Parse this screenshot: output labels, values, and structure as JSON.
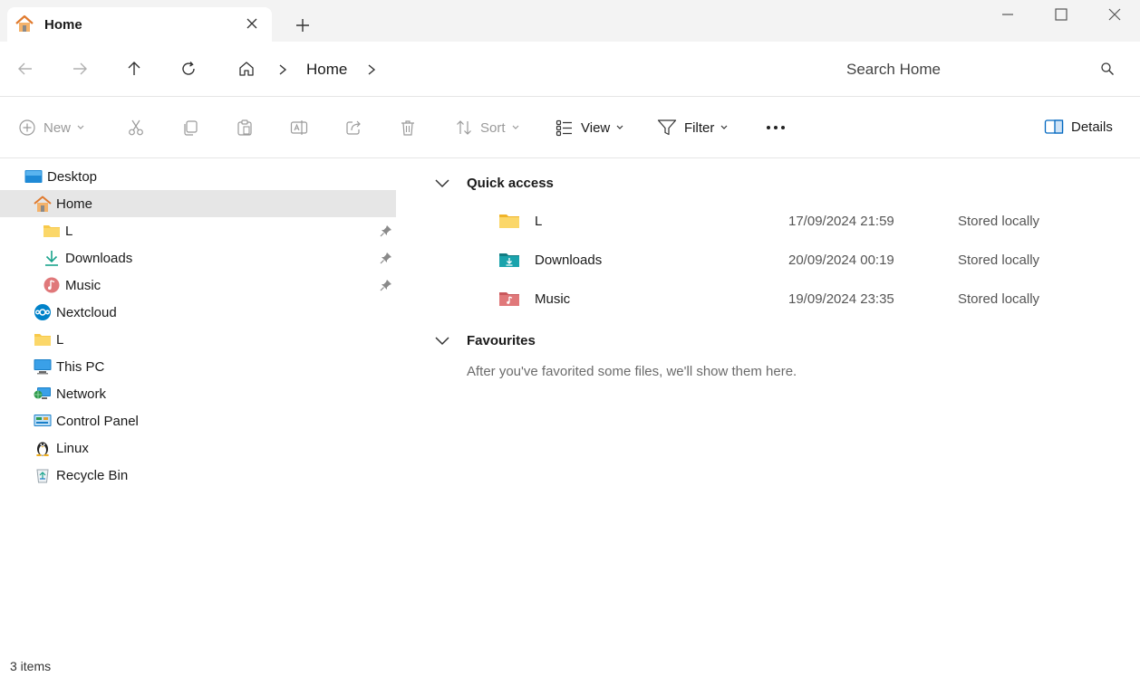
{
  "window": {
    "tab_title": "Home"
  },
  "address": {
    "crumb": "Home",
    "search_placeholder": "Search Home"
  },
  "toolbar": {
    "new_label": "New",
    "sort_label": "Sort",
    "view_label": "View",
    "filter_label": "Filter",
    "details_label": "Details"
  },
  "sidebar": {
    "items": [
      {
        "label": "Desktop",
        "icon": "desktop-icon"
      },
      {
        "label": "Home",
        "icon": "home-icon"
      },
      {
        "label": "L",
        "icon": "folder-icon"
      },
      {
        "label": "Downloads",
        "icon": "download-icon"
      },
      {
        "label": "Music",
        "icon": "music-icon"
      },
      {
        "label": "Nextcloud",
        "icon": "nextcloud-icon"
      },
      {
        "label": "L",
        "icon": "folder-icon"
      },
      {
        "label": "This PC",
        "icon": "monitor-icon"
      },
      {
        "label": "Network",
        "icon": "network-icon"
      },
      {
        "label": "Control Panel",
        "icon": "control-panel-icon"
      },
      {
        "label": "Linux",
        "icon": "linux-icon"
      },
      {
        "label": "Recycle Bin",
        "icon": "recycle-bin-icon"
      }
    ]
  },
  "main": {
    "quick_access_title": "Quick access",
    "favourites_title": "Favourites",
    "favourites_empty": "After you've favorited some files, we'll show them here.",
    "files": [
      {
        "name": "L",
        "date": "17/09/2024 21:59",
        "status": "Stored locally"
      },
      {
        "name": "Downloads",
        "date": "20/09/2024 00:19",
        "status": "Stored locally"
      },
      {
        "name": "Music",
        "date": "19/09/2024 23:35",
        "status": "Stored locally"
      }
    ]
  },
  "status": {
    "count": "3 items"
  },
  "colors": {
    "accent": "#0067c0",
    "folder": "#f8c94a",
    "selected": "#e6e6e6"
  }
}
